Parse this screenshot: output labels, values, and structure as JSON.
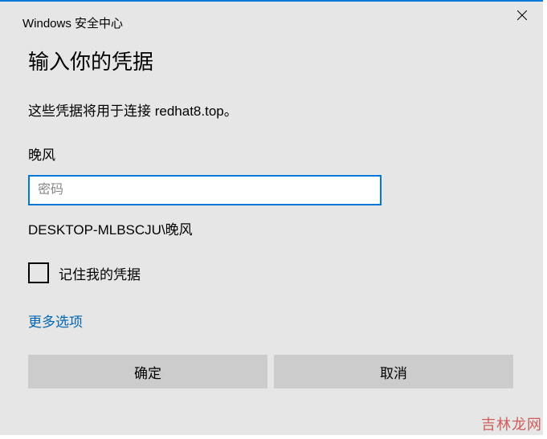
{
  "header": {
    "title": "Windows 安全中心"
  },
  "dialog": {
    "title": "输入你的凭据",
    "description": "这些凭据将用于连接 redhat8.top。",
    "username": "晚风",
    "password_placeholder": "密码",
    "password_value": "",
    "domain_user": "DESKTOP-MLBSCJU\\晚风",
    "remember_label": "记住我的凭据",
    "remember_checked": false,
    "more_options": "更多选项"
  },
  "buttons": {
    "ok": "确定",
    "cancel": "取消"
  },
  "watermark": "吉林龙网"
}
